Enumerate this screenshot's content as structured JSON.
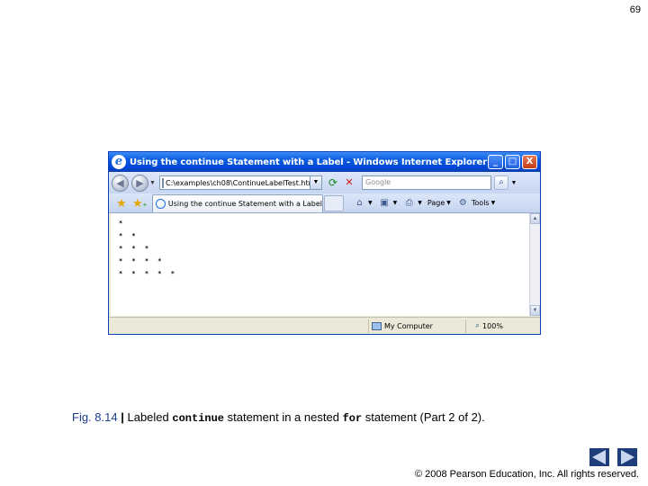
{
  "slide": {
    "page_number": "69",
    "caption": {
      "figure": "Fig. 8.14",
      "separator": "|",
      "text_1": "Labeled",
      "code_1": "continue",
      "text_2": "statement in a nested",
      "code_2": "for",
      "text_3": "statement (Part 2 of 2)."
    },
    "copyright": "© 2008 Pearson Education, Inc.  All rights reserved."
  },
  "browser": {
    "window_title": "Using the continue Statement with a Label - Windows Internet Explorer",
    "title_buttons": {
      "minimize": "_",
      "maximize": "□",
      "close": "X"
    },
    "address": "C:\\examples\\ch08\\ContinueLabelTest.html",
    "search_placeholder": "Google",
    "tab_title": "Using the continue Statement with a Label",
    "commands": {
      "page": "Page",
      "tools": "Tools"
    },
    "output_rows": [
      "*",
      "* *",
      "* * *",
      "* * * *",
      "* * * * *"
    ],
    "status": {
      "zone": "My Computer",
      "zoom": "100%"
    }
  }
}
